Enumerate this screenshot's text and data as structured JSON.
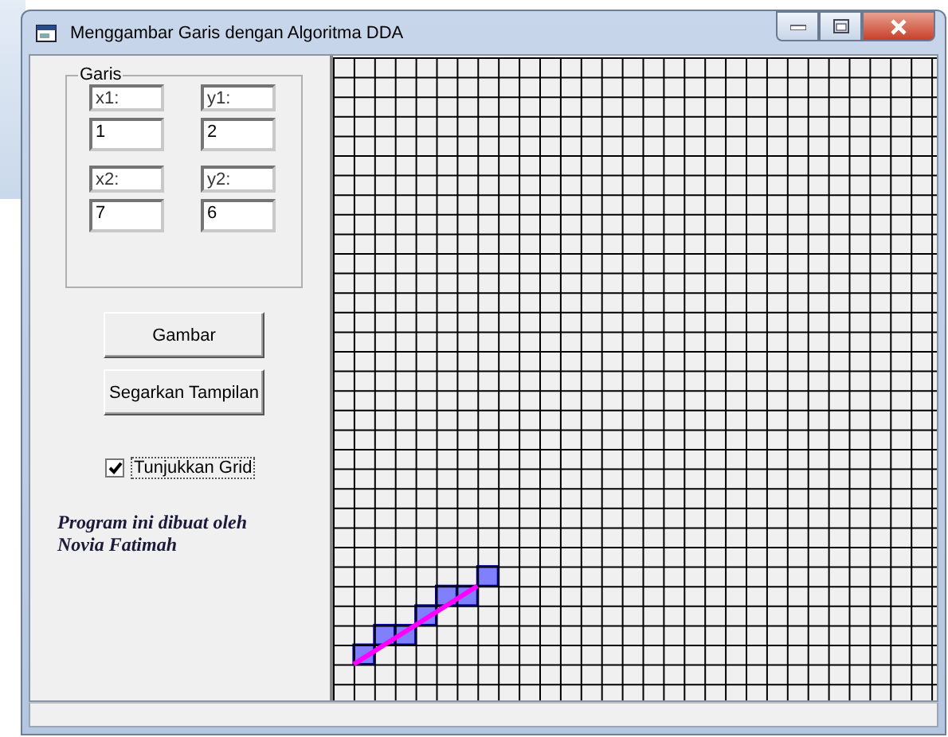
{
  "window": {
    "title": "Menggambar Garis dengan Algoritma DDA"
  },
  "group": {
    "title": "Garis",
    "fields": [
      {
        "label": "x1:",
        "value": "1"
      },
      {
        "label": "y1:",
        "value": "2"
      },
      {
        "label": "x2:",
        "value": "7"
      },
      {
        "label": "y2:",
        "value": "6"
      }
    ]
  },
  "buttons": [
    "Gambar",
    "Segarkan Tampilan"
  ],
  "show_grid": {
    "label": "Tunjukkan Grid",
    "checked": true
  },
  "credit": [
    "Program ini dibuat oleh",
    "Novia Fatimah"
  ]
}
